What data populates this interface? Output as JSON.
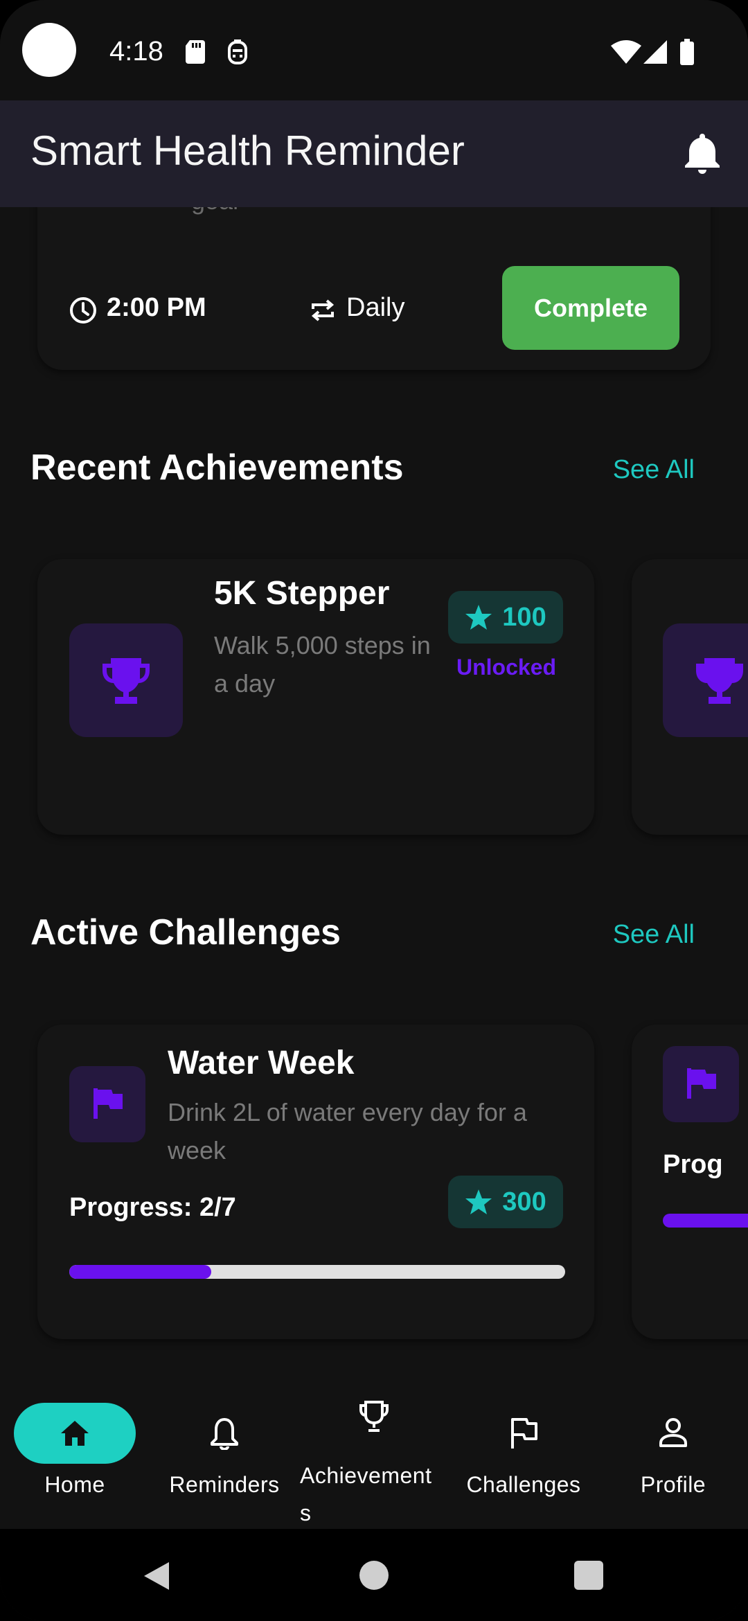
{
  "status_bar": {
    "time": "4:18",
    "icons": [
      "sd-card-icon",
      "sim-icon",
      "wifi-icon",
      "signal-icon",
      "battery-icon"
    ]
  },
  "app_bar": {
    "title": "Smart Health Reminder",
    "action_icon": "bell-icon"
  },
  "reminder": {
    "subtitle": "goal",
    "time": "2:00 PM",
    "frequency": "Daily",
    "complete_label": "Complete"
  },
  "achievements": {
    "title": "Recent Achievements",
    "see_all_label": "See All",
    "items": [
      {
        "title": "5K Stepper",
        "description": "Walk 5,000 steps in a day",
        "points": "100",
        "status": "Unlocked",
        "icon": "trophy-icon"
      }
    ]
  },
  "challenges": {
    "title": "Active Challenges",
    "see_all_label": "See All",
    "items": [
      {
        "title": "Water Week",
        "description": "Drink 2L of water every day for a week",
        "progress_label": "Progress: 2/7",
        "progress_current": 2,
        "progress_total": 7,
        "points": "300",
        "icon": "flag-icon"
      },
      {
        "progress_label_partial": "Prog",
        "icon": "flag-icon"
      }
    ]
  },
  "bottom_nav": {
    "items": [
      {
        "label": "Home",
        "icon": "home-icon",
        "active": true
      },
      {
        "label": "Reminders",
        "icon": "bell-outline-icon",
        "active": false
      },
      {
        "label": "Achievements",
        "label_line1": "Achievement",
        "label_line2": "s",
        "icon": "trophy-outline-icon",
        "active": false
      },
      {
        "label": "Challenges",
        "icon": "flag-outline-icon",
        "active": false
      },
      {
        "label": "Profile",
        "icon": "person-icon",
        "active": false
      }
    ]
  },
  "colors": {
    "background": "#121212",
    "app_bar": "#211f2c",
    "accent_teal": "#1ec8c0",
    "accent_purple": "#6a11ee",
    "complete_green": "#4caf50"
  }
}
